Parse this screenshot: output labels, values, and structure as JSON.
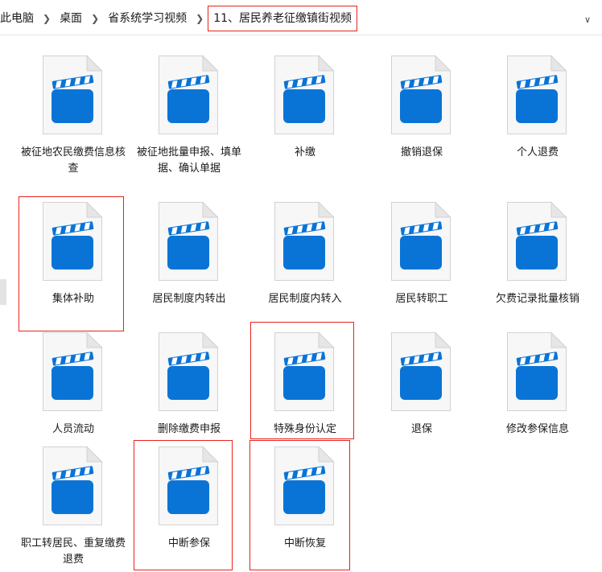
{
  "breadcrumb": {
    "items": [
      "此电脑",
      "桌面",
      "省系统学习视频"
    ],
    "current": "11、居民养老征缴镇街视频"
  },
  "icons": {
    "dropdown": "chevron-down-icon",
    "file": "video-file-clapperboard-icon"
  },
  "colors": {
    "accent": "#0a74d6",
    "highlight": "#e8231b"
  },
  "files": [
    {
      "name": "被征地农民缴费信息核查"
    },
    {
      "name": "被征地批量申报、填单据、确认单据"
    },
    {
      "name": "补缴"
    },
    {
      "name": "撤销退保"
    },
    {
      "name": "个人退费"
    },
    {
      "name": "集体补助"
    },
    {
      "name": "居民制度内转出"
    },
    {
      "name": "居民制度内转入"
    },
    {
      "name": "居民转职工"
    },
    {
      "name": "欠费记录批量核销"
    },
    {
      "name": "人员流动"
    },
    {
      "name": "删除缴费申报"
    },
    {
      "name": "特殊身份认定"
    },
    {
      "name": "退保"
    },
    {
      "name": "修改参保信息"
    },
    {
      "name": "职工转居民、重复缴费退费"
    },
    {
      "name": "中断参保"
    },
    {
      "name": "中断恢复"
    }
  ]
}
